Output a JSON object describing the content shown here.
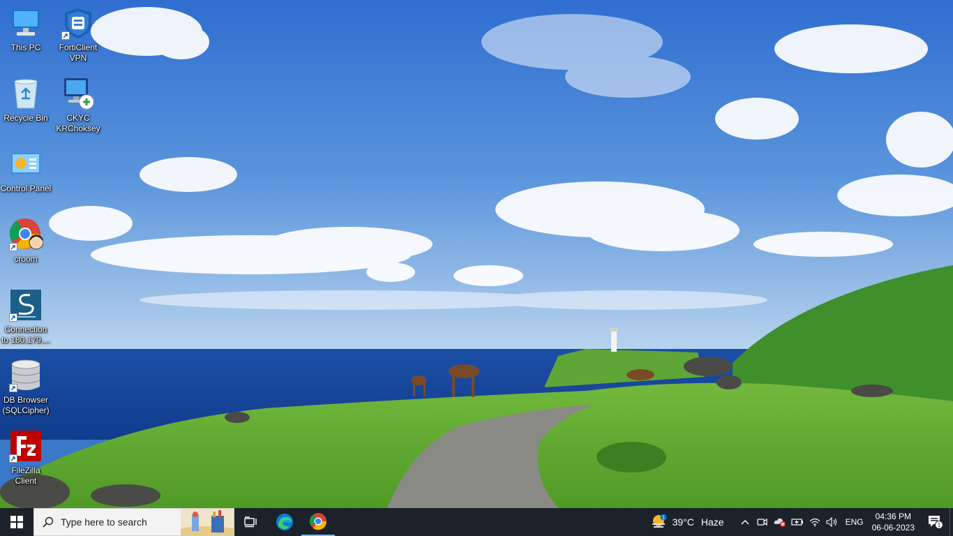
{
  "desktop": {
    "icons": [
      {
        "label": "This PC",
        "icon": "computer-icon"
      },
      {
        "label": "FortiClient VPN",
        "icon": "forticlient-shield-icon"
      },
      {
        "label": "Recycle Bin",
        "icon": "recycle-bin-icon"
      },
      {
        "label": "CKYC KRChoksey",
        "icon": "remote-desktop-icon"
      },
      {
        "label": "Control Panel",
        "icon": "control-panel-icon"
      },
      {
        "label": "croom",
        "icon": "chrome-profile-icon"
      },
      {
        "label": "Connection to 180.179....",
        "icon": "putty-connection-icon"
      },
      {
        "label": "DB Browser (SQLCipher)",
        "icon": "database-icon"
      },
      {
        "label": "FileZilla Client",
        "icon": "filezilla-icon"
      }
    ]
  },
  "taskbar": {
    "search_placeholder": "Type here to search",
    "apps": [
      "task-view-icon",
      "edge-icon",
      "chrome-icon"
    ],
    "weather": {
      "temp": "39°C",
      "condition": "Haze",
      "badge": "1"
    },
    "language": "ENG",
    "time": "04:36 PM",
    "date": "06-06-2023",
    "notification_count": "1"
  },
  "colors": {
    "taskbar_bg": "#1c2229",
    "accent": "#0078d4"
  }
}
